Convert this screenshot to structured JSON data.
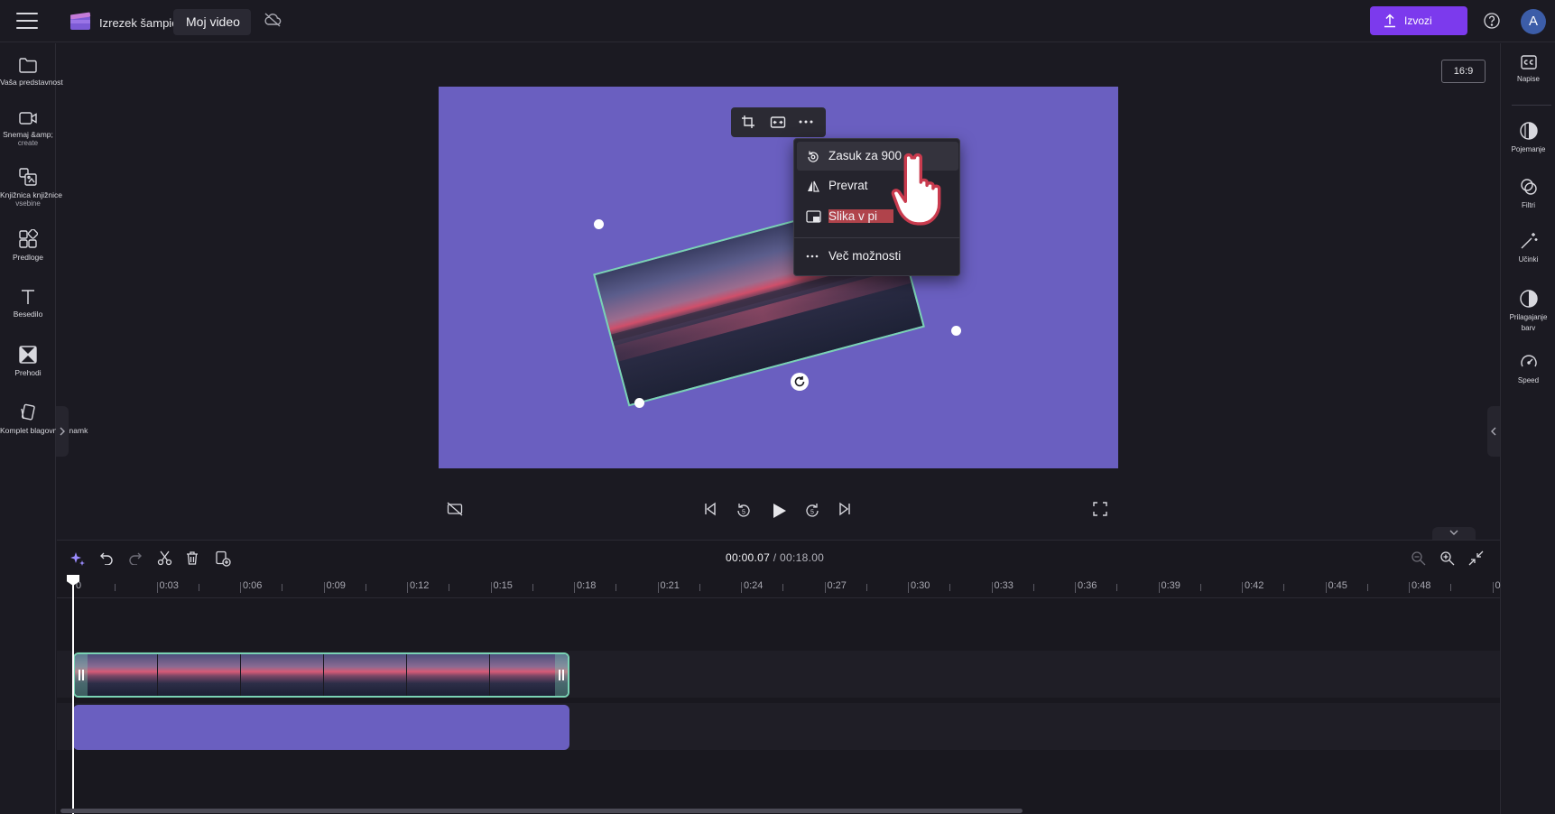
{
  "header": {
    "project_name": "Izrezek šampion",
    "video_title": "Moj video",
    "export_label": "Izvozi",
    "avatar_initial": "A"
  },
  "left_sidebar": {
    "items": [
      {
        "label": "Vaša predstavnost",
        "icon": "folder-icon"
      },
      {
        "label": "Snemaj &amp;",
        "sublabel": "create",
        "icon": "camera-icon"
      },
      {
        "label": "Knjižnica knjižnice",
        "sublabel": "vsebine",
        "icon": "content-library-icon"
      },
      {
        "label": "Predloge",
        "icon": "templates-icon"
      },
      {
        "label": "Besedilo",
        "icon": "text-icon"
      },
      {
        "label": "Prehodi",
        "icon": "transitions-icon"
      },
      {
        "label": "Komplet blagovnih znamk",
        "icon": "brand-kit-icon"
      }
    ]
  },
  "right_sidebar": {
    "items": [
      {
        "label": "Napise",
        "icon": "captions-icon"
      },
      {
        "label": "Pojemanje",
        "icon": "fade-icon"
      },
      {
        "label": "Filtri",
        "icon": "filters-icon"
      },
      {
        "label": "Učinki",
        "icon": "effects-icon"
      },
      {
        "label": "Prilagajanje barv",
        "icon": "color-adjust-icon"
      },
      {
        "label": "Speed",
        "icon": "speed-icon"
      }
    ]
  },
  "preview": {
    "aspect_ratio": "16:9",
    "background_color": "#6a5fc0",
    "context_menu": {
      "items": [
        {
          "label": "Zasuk za 900",
          "icon": "rotate-icon",
          "active": true
        },
        {
          "label": "Prevrat",
          "icon": "flip-icon"
        },
        {
          "label": "Slika v pi",
          "icon": "picture-in-picture-icon",
          "highlighted": true
        },
        {
          "label": "Več možnosti",
          "icon": "more-icon"
        }
      ]
    }
  },
  "timeline": {
    "current_time": "00:00.07",
    "total_time": "/ 00:18.00",
    "ruler_labels": [
      "0",
      "0:03",
      "0:06",
      "0:09",
      "0:12",
      "0:15",
      "0:18",
      "0:21",
      "0:24",
      "0:27",
      "0:30",
      "0:33",
      "0:36",
      "0:39",
      "0:42",
      "0:45",
      "0:48",
      "0"
    ]
  },
  "colors": {
    "accent": "#7c3aed",
    "selection": "#7ad3b4",
    "canvas": "#6a5fc0"
  }
}
